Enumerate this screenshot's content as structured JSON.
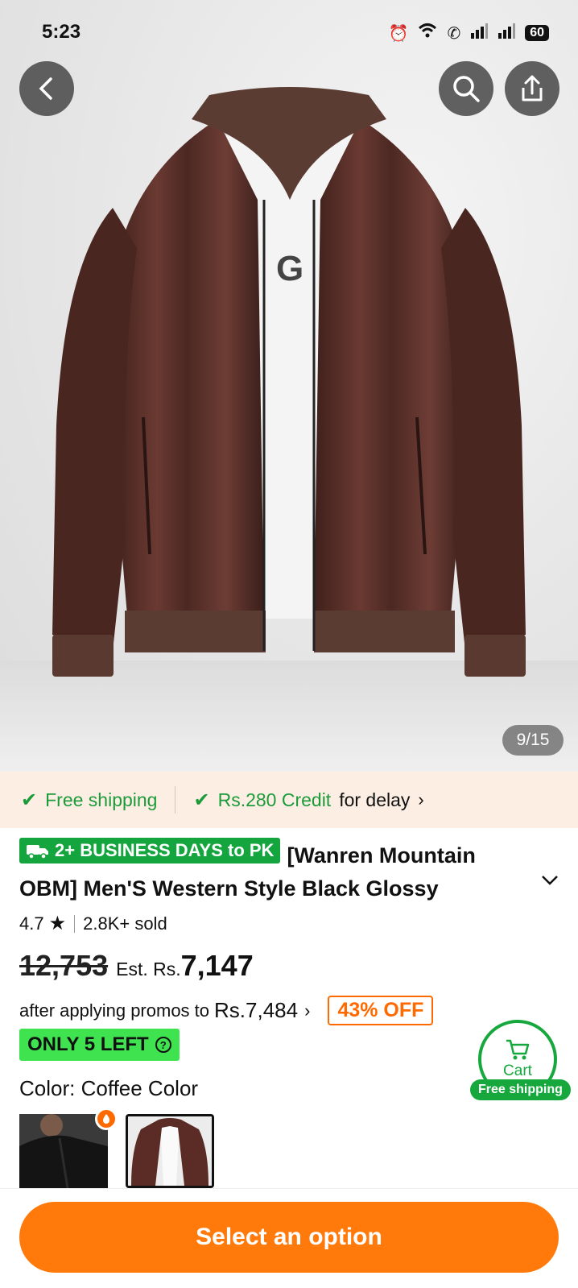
{
  "status_bar": {
    "time": "5:23",
    "battery": "60"
  },
  "gallery": {
    "counter": "9/15",
    "shirt_letter": "G"
  },
  "shipping_strip": {
    "free_shipping": "Free shipping",
    "credit_amount": "Rs.280 Credit",
    "credit_suffix": "for delay"
  },
  "product": {
    "delivery_badge": "2+ BUSINESS DAYS to PK",
    "title": "[Wanren Mountain OBM] Men'S Western Style Black Glossy",
    "rating": "4.7",
    "sold": "2.8K+ sold",
    "original_price": "12,753",
    "est_prefix": "Est. Rs.",
    "est_price": "7,147",
    "promo_text": "after applying promos to",
    "promo_price": "Rs.7,484",
    "discount": "43% OFF",
    "stock": "ONLY 5 LEFT",
    "color_label": "Color: Coffee Color"
  },
  "cart": {
    "label": "Cart",
    "shipping": "Free shipping"
  },
  "actions": {
    "select_option": "Select an option"
  },
  "colors": {
    "accent_orange": "#ff7a0b",
    "green": "#16a83d",
    "strip_bg": "#fdeee4"
  }
}
